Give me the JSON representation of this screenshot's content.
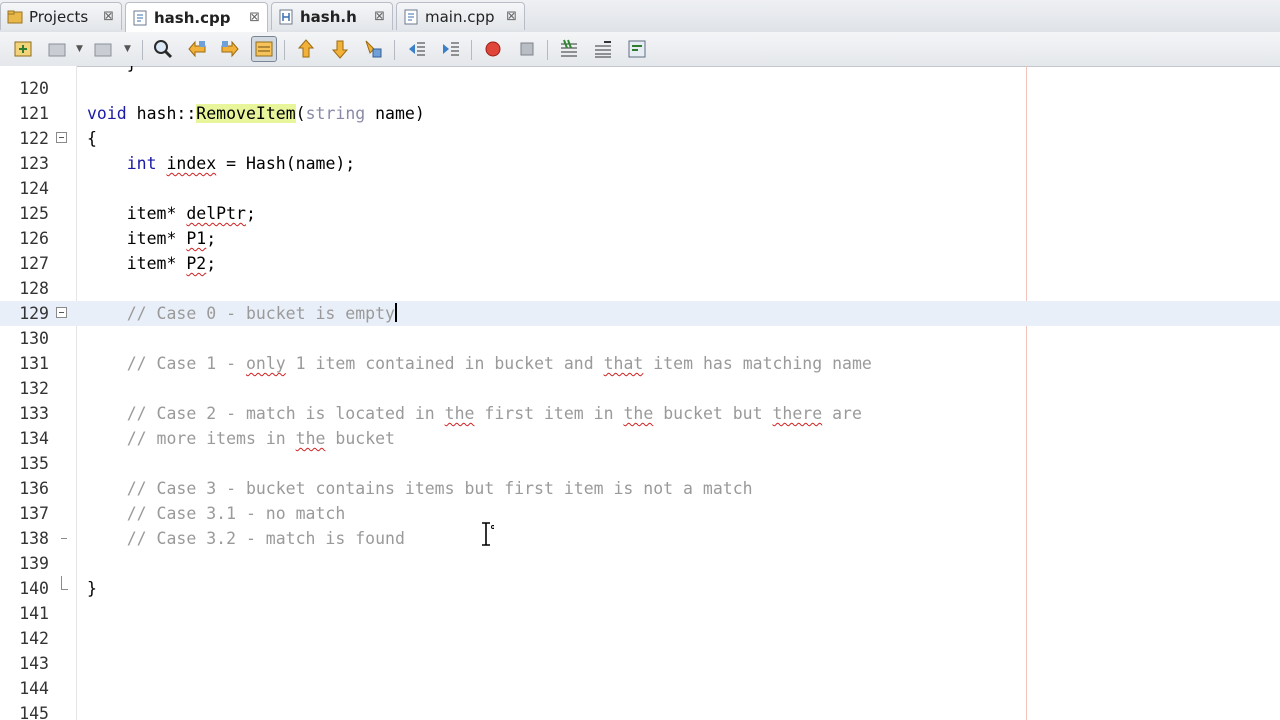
{
  "tabs": [
    {
      "label": "Projects",
      "icon": "projects-icon",
      "active": false
    },
    {
      "label": "hash.cpp",
      "icon": "cpp-file-icon",
      "active": true
    },
    {
      "label": "hash.h",
      "icon": "header-file-icon",
      "active": false
    },
    {
      "label": "main.cpp",
      "icon": "cpp-file-icon",
      "active": false
    }
  ],
  "tab_close_glyph": "⊠",
  "toolbar": {
    "icons": [
      "new-project-icon",
      "open-project-icon",
      "close-project-icon",
      "find-icon",
      "find-previous-icon",
      "find-next-icon",
      "toggle-highlight-icon",
      "previous-bookmark-icon",
      "next-bookmark-icon",
      "toggle-bookmark-icon",
      "shift-left-icon",
      "shift-right-icon",
      "start-macro-icon",
      "stop-macro-icon",
      "comment-icon",
      "uncomment-icon",
      "run-icon"
    ]
  },
  "colors": {
    "keyword": "#1a1aa6",
    "comment": "#9a9a9a",
    "highlight": "#e9f59a",
    "current_line": "#e9eff8",
    "margin": "#f3c4bc"
  },
  "editor": {
    "top_partial_line": "    }",
    "lines": [
      {
        "num": "120",
        "text": ""
      },
      {
        "num": "121",
        "text": "void hash::RemoveItem(string name)"
      },
      {
        "num": "122",
        "text": "{"
      },
      {
        "num": "123",
        "text": "    int index = Hash(name);"
      },
      {
        "num": "124",
        "text": ""
      },
      {
        "num": "125",
        "text": "    item* delPtr;"
      },
      {
        "num": "126",
        "text": "    item* P1;"
      },
      {
        "num": "127",
        "text": "    item* P2;"
      },
      {
        "num": "128",
        "text": ""
      },
      {
        "num": "129",
        "text": "    // Case 0 - bucket is empty"
      },
      {
        "num": "130",
        "text": ""
      },
      {
        "num": "131",
        "text": "    // Case 1 - only 1 item contained in bucket and that item has matching name"
      },
      {
        "num": "132",
        "text": ""
      },
      {
        "num": "133",
        "text": "    // Case 2 - match is located in the first item in the bucket but there are"
      },
      {
        "num": "134",
        "text": "    // more items in the bucket"
      },
      {
        "num": "135",
        "text": ""
      },
      {
        "num": "136",
        "text": "    // Case 3 - bucket contains items but first item is not a match"
      },
      {
        "num": "137",
        "text": "    // Case 3.1 - no match"
      },
      {
        "num": "138",
        "text": "    // Case 3.2 - match is found"
      },
      {
        "num": "139",
        "text": ""
      },
      {
        "num": "140",
        "text": "}"
      },
      {
        "num": "141",
        "text": ""
      },
      {
        "num": "142",
        "text": ""
      },
      {
        "num": "143",
        "text": ""
      },
      {
        "num": "144",
        "text": ""
      },
      {
        "num": "145",
        "text": ""
      }
    ],
    "current_line": "129"
  },
  "code_tokens": {
    "l121": {
      "kw": "void",
      "cls": " hash::",
      "fn": "RemoveItem",
      "paren": "(",
      "type": "string",
      "rest": " name)"
    },
    "l123": {
      "kw": "int",
      "sp": " ",
      "var": "index",
      "rest": " = Hash(name);"
    },
    "l125": {
      "a": "item* ",
      "b": "delPtr",
      "c": ";"
    },
    "l126": {
      "a": "item* ",
      "b": "P1",
      "c": ";"
    },
    "l127": {
      "a": "item* ",
      "b": "P2",
      "c": ";"
    },
    "l131": {
      "a": "// Case 1 - ",
      "b": "only",
      "c": " 1 item contained in bucket and ",
      "d": "that",
      "e": " item has matching name"
    },
    "l133": {
      "a": "// Case 2 - match is located in ",
      "b": "the",
      "c": " first item in ",
      "d": "the",
      "e": " bucket but ",
      "f": "there",
      "g": " are"
    },
    "l134": {
      "a": "// more items in ",
      "b": "the",
      "c": " bucket"
    }
  }
}
